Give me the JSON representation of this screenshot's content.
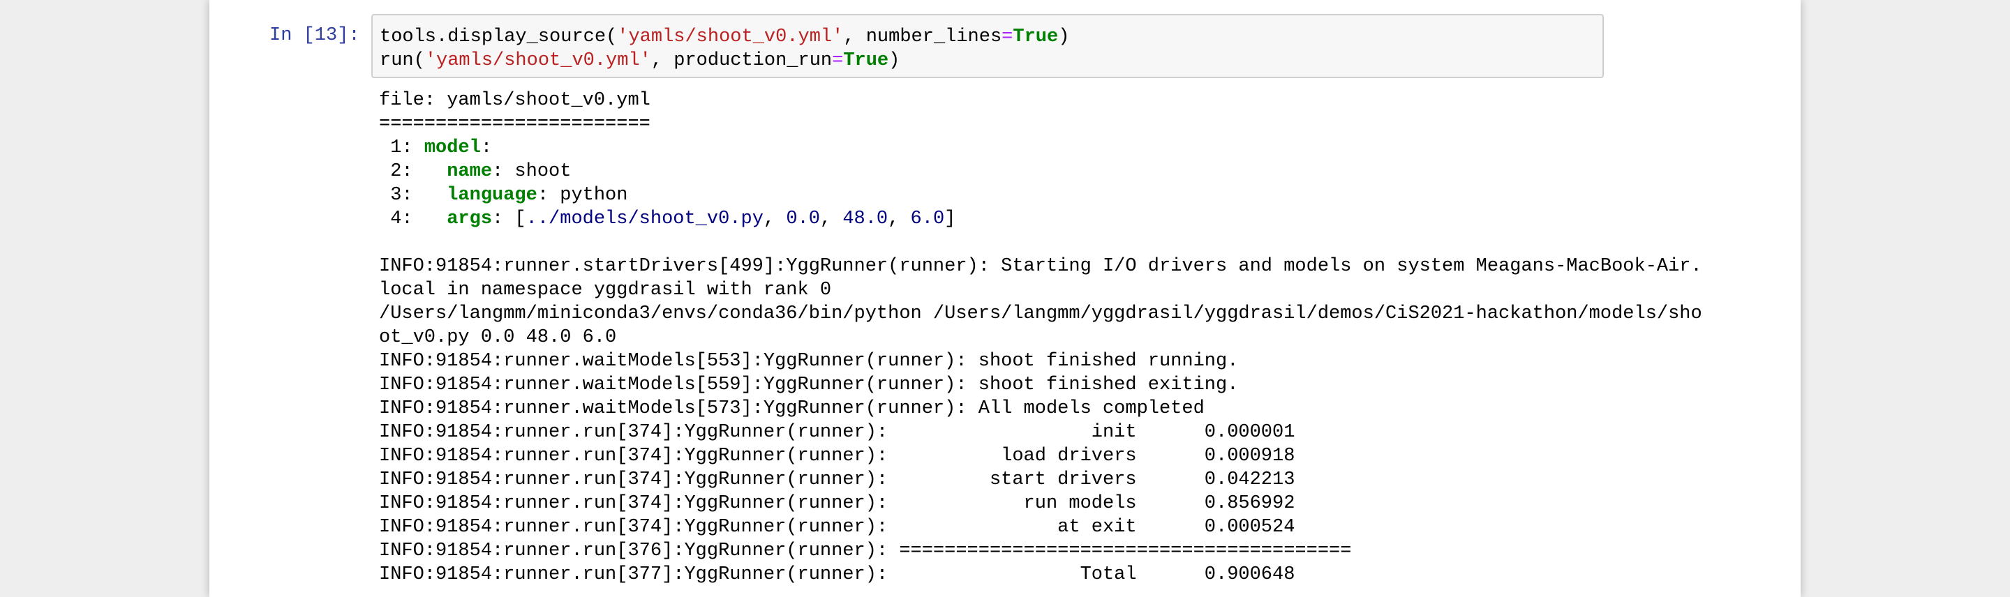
{
  "cell": {
    "prompt": "In [13]:",
    "code": {
      "line1": {
        "pre": "tools.display_source(",
        "str1": "'yamls/shoot_v0.yml'",
        "mid": ", number_lines",
        "eq": "=",
        "kw": "True",
        "post": ")"
      },
      "line2": {
        "pre": "run(",
        "str1": "'yamls/shoot_v0.yml'",
        "mid": ", production_run",
        "eq": "=",
        "kw": "True",
        "post": ")"
      }
    }
  },
  "output": {
    "file_line": "file: yamls/shoot_v0.yml",
    "separator": "========================",
    "yaml": {
      "l1_num": " 1: ",
      "l1_key": "model",
      "l1_rest": ":",
      "l2_num": " 2:   ",
      "l2_key": "name",
      "l2_rest": ": shoot",
      "l3_num": " 3:   ",
      "l3_key": "language",
      "l3_rest": ": python",
      "l4_num": " 4:   ",
      "l4_key": "args",
      "l4_open": ": [",
      "l4_path": "../models/shoot_v0.py",
      "l4_c1": ", ",
      "l4_v1": "0.0",
      "l4_c2": ", ",
      "l4_v2": "48.0",
      "l4_c3": ", ",
      "l4_v3": "6.0",
      "l4_close": "]"
    },
    "log": [
      "INFO:91854:runner.startDrivers[499]:YggRunner(runner): Starting I/O drivers and models on system Meagans-MacBook-Air.",
      "local in namespace yggdrasil with rank 0",
      "/Users/langmm/miniconda3/envs/conda36/bin/python /Users/langmm/yggdrasil/yggdrasil/demos/CiS2021-hackathon/models/sho",
      "ot_v0.py 0.0 48.0 6.0",
      "INFO:91854:runner.waitModels[553]:YggRunner(runner): shoot finished running.",
      "INFO:91854:runner.waitModels[559]:YggRunner(runner): shoot finished exiting.",
      "INFO:91854:runner.waitModels[573]:YggRunner(runner): All models completed",
      "INFO:91854:runner.run[374]:YggRunner(runner):                  init      0.000001",
      "INFO:91854:runner.run[374]:YggRunner(runner):          load drivers      0.000918",
      "INFO:91854:runner.run[374]:YggRunner(runner):         start drivers      0.042213",
      "INFO:91854:runner.run[374]:YggRunner(runner):            run models      0.856992",
      "INFO:91854:runner.run[374]:YggRunner(runner):               at exit      0.000524",
      "INFO:91854:runner.run[376]:YggRunner(runner): ========================================",
      "INFO:91854:runner.run[377]:YggRunner(runner):                 Total      0.900648"
    ]
  }
}
